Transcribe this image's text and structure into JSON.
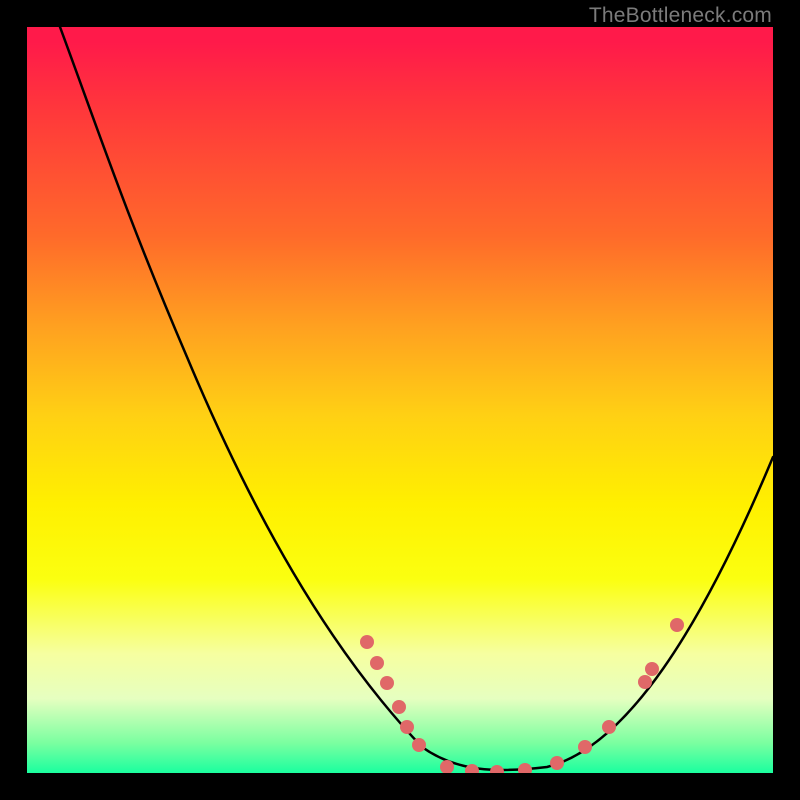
{
  "watermark": "TheBottleneck.com",
  "chart_data": {
    "type": "line",
    "title": "",
    "xlabel": "",
    "ylabel": "",
    "xlim": [
      0,
      100
    ],
    "ylim": [
      0,
      100
    ],
    "background_gradient": {
      "orientation": "vertical",
      "stops": [
        {
          "pos": 0.0,
          "color": "#ff1a4a"
        },
        {
          "pos": 0.3,
          "color": "#ff6a2a"
        },
        {
          "pos": 0.55,
          "color": "#ffe000"
        },
        {
          "pos": 0.85,
          "color": "#f6ffa0"
        },
        {
          "pos": 1.0,
          "color": "#1aff9f"
        }
      ]
    },
    "series": [
      {
        "name": "curve",
        "stroke": "#000000",
        "x": [
          4,
          10,
          20,
          30,
          40,
          50,
          55,
          60,
          65,
          70,
          75,
          80,
          85,
          90,
          95,
          100
        ],
        "y": [
          100,
          88,
          68,
          50,
          34,
          18,
          10,
          3,
          1,
          1,
          3,
          8,
          15,
          25,
          35,
          43
        ]
      },
      {
        "name": "markers",
        "marker_color": "#e06868",
        "x": [
          45,
          46,
          48,
          50,
          51,
          53,
          56,
          60,
          63,
          67,
          71,
          75,
          78,
          83,
          84,
          87
        ],
        "y": [
          18,
          15,
          12,
          9,
          6,
          4,
          1,
          1,
          1,
          1,
          2,
          4,
          6,
          12,
          14,
          20
        ]
      }
    ]
  }
}
